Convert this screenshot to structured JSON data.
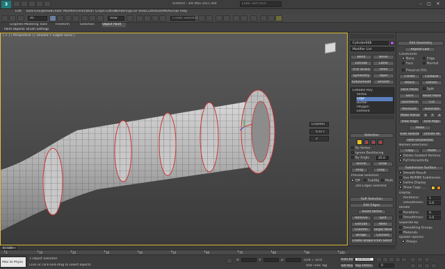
{
  "app": {
    "title": "Untitled - 3ds Max 2015 x64",
    "search_placeholder": "Enter Text Here",
    "logo": "3ds-max-logo"
  },
  "menu": [
    "Edit",
    "Tools",
    "Group",
    "Views",
    "Create",
    "Modifiers",
    "Animation",
    "Graph Editors",
    "Rendering",
    "Civil View",
    "Customize",
    "MAXScript",
    "Help"
  ],
  "toolbar": {
    "selection_filter": "All",
    "view_dropdown": "View",
    "named_set": "Create Selection Se"
  },
  "ribbon_tabs": [
    "Graphite Modeling Tools",
    "Freeform",
    "Selection",
    "Object Paint"
  ],
  "ribbon_row2": [
    "Paint Objects",
    "Brush Settings"
  ],
  "viewport": {
    "label": "[ + ] [ Perspective ] [ Shaded + Edged Faces ]"
  },
  "caddy": {
    "title": "Chamfer",
    "amount": "0.477",
    "segments": "2"
  },
  "cmd": {
    "object_name": "Cylinder008",
    "modifier_list": "Modifier List",
    "buttons": [
      [
        "Bend",
        "Bevel"
      ],
      [
        "Extrude",
        "Lathe"
      ],
      [
        "FFD 3x3x3",
        "Shell"
      ],
      [
        "Symmetry",
        "Taper"
      ],
      [
        "TurboSmooth",
        "Smooth"
      ]
    ],
    "stack": [
      "Editable Poly",
      "Vertex",
      "Edge",
      "Border",
      "Polygon",
      "Element"
    ],
    "selection": {
      "title": "Selection",
      "by_vertex": "By Vertex",
      "ignore_backfacing": "Ignore Backfacing",
      "by_angle": "By Angle",
      "angle_value": "45.0",
      "shrink": "Shrink",
      "grow": "Grow",
      "ring": "Ring",
      "loop": "Loop",
      "preview_title": "Preview Selection",
      "preview_off": "Off",
      "preview_subobj": "SubObj",
      "preview_multi": "Multi",
      "status": "260 Edges Selected"
    },
    "soft_selection": "Soft Selection",
    "edit_edges": {
      "title": "Edit Edges",
      "insert_vertex": "Insert Vertex",
      "remove": "Remove",
      "split": "Split",
      "extrude": "Extrude",
      "weld": "Weld",
      "chamfer": "Chamfer",
      "target_weld": "Target Weld",
      "bridge": "Bridge",
      "connect": "Connect",
      "create_shape": "Create Shape From Selection",
      "weight_label": "Weight:",
      "weight_value": "1.0",
      "crease_label": "Crease:",
      "crease_value": "0.0"
    }
  },
  "geom": {
    "title": "Edit Geometry",
    "repeat_last": "Repeat Last",
    "constraints": "Constraints",
    "none": "None",
    "edge": "Edge",
    "face": "Face",
    "normal": "Normal",
    "preserve_uvs": "Preserve UVs",
    "create": "Create",
    "collapse": "Collapse",
    "attach": "Attach",
    "detach": "Detach",
    "slice_plane": "Slice Plane",
    "split": "Split",
    "slice": "Slice",
    "reset_plane": "Reset Plane",
    "quickslice": "QuickSlice",
    "cut": "Cut",
    "msmooth": "MSmooth",
    "tessellate": "Tessellate",
    "make_planar": "Make Planar",
    "x": "X",
    "y": "Y",
    "z": "Z",
    "view_align": "View Align",
    "grid_align": "Grid Align",
    "relax": "Relax",
    "hide_selected": "Hide Selected",
    "unhide_all": "Unhide All",
    "hide_unselected": "Hide Unselected",
    "named_selections": "Named Selections:",
    "copy": "Copy",
    "paste": "Paste",
    "delete_isolated": "Delete Isolated Vertices",
    "full_interactivity": "Full Interactivity"
  },
  "subdiv": {
    "title": "Subdivision Surface",
    "smooth_result": "Smooth Result",
    "use_nurms": "Use NURMS Subdivision",
    "isoline": "Isoline Display",
    "show_cage": "Show Cage......",
    "display": "Display",
    "iterations": "Iterations:",
    "iterations_value": "1",
    "smoothness": "Smoothness:",
    "smoothness_value": "1.0",
    "render": "Render",
    "r_iterations": "Iterations:",
    "r_iterations_value": "0",
    "r_smoothness": "Smoothness:",
    "r_smoothness_value": "1.0",
    "separate_by": "Separate By",
    "smoothing_groups": "Smoothing Groups",
    "materials": "Materials",
    "update_options": "Update Options",
    "always": "Always",
    "when_rendering": "When Rendering",
    "manually": "Manually"
  },
  "timeline": {
    "frame": "0 / 100",
    "ticks": [
      "0",
      "10",
      "20",
      "30",
      "40",
      "50",
      "60",
      "70",
      "80",
      "90",
      "100"
    ]
  },
  "status": {
    "script": "Max to Physx",
    "objects": "1 Object Selected",
    "prompt": "Click or click-and-drag to select objects",
    "x": "X:",
    "y": "Y:",
    "z": "Z:",
    "grid": "Grid = 10.0",
    "auto_key": "Auto Key",
    "selected": "Selected",
    "set_key": "Set Key",
    "key_filters": "Key Filters...",
    "add_time_tag": "Add Time Tag",
    "frame_value": "0"
  },
  "colors": {
    "accent_yellow": "#e2c32a",
    "selected_edge": "#cc3333",
    "panel": "#444444",
    "highlight": "#5b7fbf"
  }
}
